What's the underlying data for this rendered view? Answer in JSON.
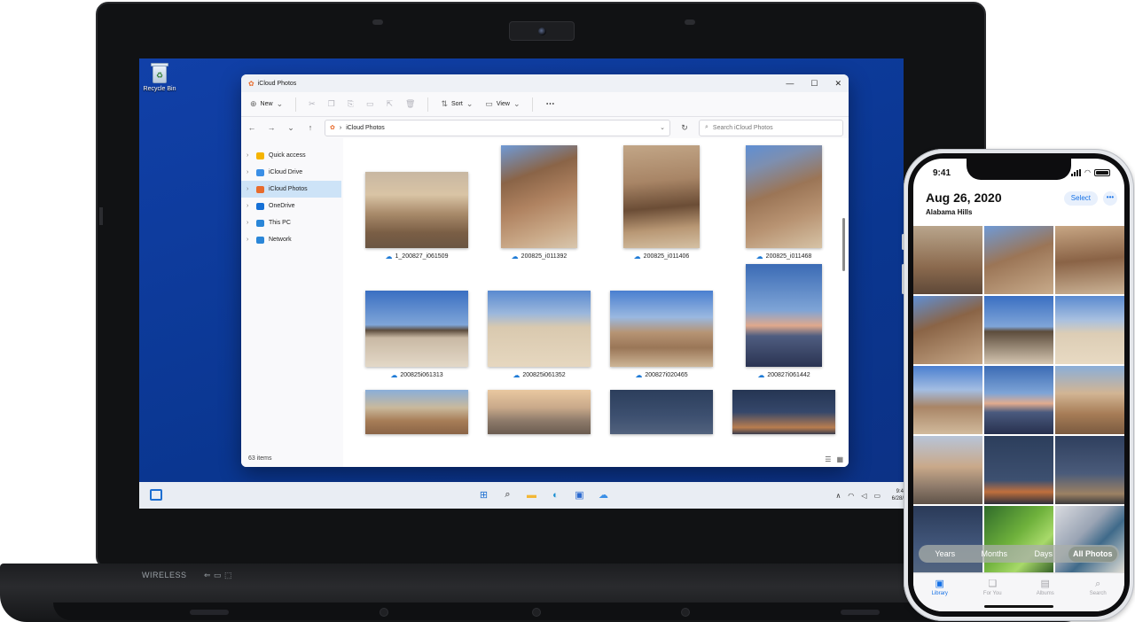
{
  "laptop": {
    "base_label_wireless": "WIRELESS",
    "base_label_ports": "⇐ ▭ ⬚"
  },
  "desktop": {
    "recycle_bin_label": "Recycle Bin"
  },
  "explorer": {
    "title": "iCloud Photos",
    "window_controls": {
      "minimize": "—",
      "maximize": "☐",
      "close": "✕"
    },
    "command_bar": {
      "new_label": "New",
      "sort_label": "Sort",
      "view_label": "View",
      "more_label": "⋯"
    },
    "address": {
      "path_separator": "›",
      "path": "iCloud Photos",
      "search_placeholder": "Search iCloud Photos"
    },
    "nav_pane": [
      {
        "label": "Quick access",
        "icon": "star-icon",
        "color": "#f5b400"
      },
      {
        "label": "iCloud Drive",
        "icon": "cloud-icon",
        "color": "#3b8fe6"
      },
      {
        "label": "iCloud Photos",
        "icon": "photos-icon",
        "color": "#e86b2c",
        "selected": true
      },
      {
        "label": "OneDrive",
        "icon": "onedrive-icon",
        "color": "#1670d6"
      },
      {
        "label": "This PC",
        "icon": "computer-icon",
        "color": "#2a86d8"
      },
      {
        "label": "Network",
        "icon": "network-icon",
        "color": "#2a86d8"
      }
    ],
    "files": [
      {
        "name": "1_200827_i061509",
        "w": 116,
        "h": 86,
        "bg": "linear-gradient(180deg,#c8b7a2 0%,#d9c4a5 30%,#a88a6a 55%,#7a5e45 80%,#6b5643 100%)"
      },
      {
        "name": "200825_i011392",
        "w": 86,
        "h": 116,
        "bg": "linear-gradient(160deg,#6f9ad6 0%,#8a6447 30%,#b08361 55%,#c9a887 80%,#d8c6ad 100%)"
      },
      {
        "name": "200825_i011406",
        "w": 86,
        "h": 116,
        "bg": "linear-gradient(175deg,#c2a687 0%,#a88566 35%,#6b4d36 60%,#b89774 80%,#d4c0a3 100%)"
      },
      {
        "name": "200825_i011468",
        "w": 86,
        "h": 116,
        "bg": "linear-gradient(160deg,#5f8fd4 0%,#7d8fb0 20%,#9b7556 45%,#b89372 70%,#d6c3a6 100%)"
      },
      {
        "name": "200825i061313",
        "w": 116,
        "h": 86,
        "bg": "linear-gradient(180deg,#3a6fc2 0%,#7fa5d8 45%,#5c4c3c 52%,#c9b9a4 62%,#e3d8c7 100%)"
      },
      {
        "name": "200825i061352",
        "w": 116,
        "h": 86,
        "bg": "linear-gradient(180deg,#5a8ad0 0%,#9bb7dc 30%,#d9c9af 48%,#e6d7bf 100%)"
      },
      {
        "name": "200827i020465",
        "w": 116,
        "h": 86,
        "bg": "linear-gradient(180deg,#4a7fd0 0%,#9ab8e0 35%,#b69474 55%,#9a7657 75%,#cdb596 100%)"
      },
      {
        "name": "200827i061442",
        "w": 86,
        "h": 116,
        "bg": "linear-gradient(180deg,#3b6bb5 0%,#7ea4d6 45%,#e0a98c 60%,#4f5d80 70%,#2a3352 100%)"
      },
      {
        "name": "",
        "w": 116,
        "h": 50,
        "bg": "linear-gradient(180deg,#8aaed8 0%,#c9b99c 40%,#a77d57 70%,#8a6446 100%)"
      },
      {
        "name": "",
        "w": 116,
        "h": 50,
        "bg": "linear-gradient(180deg,#e9c8a0 0%,#c9a98a 40%,#8d7a6a 70%,#6b5c50 100%)"
      },
      {
        "name": "",
        "w": 116,
        "h": 50,
        "bg": "linear-gradient(180deg,#2c3e5c 0%,#3d5070 60%,#52627d 100%)"
      },
      {
        "name": "",
        "w": 116,
        "h": 50,
        "bg": "linear-gradient(180deg,#253553 0%,#35476a 50%,#b97d4f 85%,#3a3c4c 100%)"
      }
    ],
    "status_text": "63 items",
    "view_icons": {
      "details": "☰",
      "tiles": "▦"
    }
  },
  "taskbar": {
    "apps": [
      {
        "name": "start-icon",
        "glyph": "⊞",
        "color": "#1d6fd1"
      },
      {
        "name": "search-icon",
        "glyph": "⌕",
        "color": "#222222"
      },
      {
        "name": "file-explorer-icon",
        "glyph": "▬",
        "color": "#f2b736"
      },
      {
        "name": "edge-icon",
        "glyph": "◐",
        "color": "#1b8fd2"
      },
      {
        "name": "store-icon",
        "glyph": "▣",
        "color": "#2b6ad0"
      },
      {
        "name": "icloud-icon",
        "glyph": "☁",
        "color": "#3b8fe6"
      }
    ],
    "tray": {
      "chevron": "∧",
      "wifi": "◠",
      "volume": "◁",
      "battery": "▭"
    },
    "clock_time": "9:4",
    "clock_date": "6/28/"
  },
  "phone": {
    "status_time": "9:41",
    "date_header": "Aug 26, 2020",
    "location": "Alabama Hills",
    "select_label": "Select",
    "more_label": "•••",
    "grid": [
      "linear-gradient(180deg,#b9a58c,#8b6a4e 60%,#5e4838)",
      "linear-gradient(160deg,#6f9ad6,#9b7556 45%,#c8ab8b)",
      "linear-gradient(175deg,#c7a684,#8a6346 50%,#cbb396)",
      "linear-gradient(160deg,#5f8fd4,#8a6446 40%,#c5a686)",
      "linear-gradient(180deg,#3a6fc2,#7fa5d8 45%,#5c4c3c 52%,#d5c6b1)",
      "linear-gradient(180deg,#5a8ad0,#a8c0e0 35%,#dccdb5 55%,#e8dac3)",
      "linear-gradient(180deg,#4a7fd0,#a3bde2 35%,#a98566 60%,#d1ba9c)",
      "linear-gradient(180deg,#3b6bb5,#7ea4d6 40%,#e1ac8e 55%,#4a5a7e 68%,#27304e)",
      "linear-gradient(180deg,#8aaed8,#d2b594 40%,#a77d57 70%,#7a5a40)",
      "linear-gradient(180deg,#b7c4d8,#c9a98a 45%,#8d7a6a 75%,#5f5248)",
      "linear-gradient(180deg,#2c3e5c,#3d5070 65%,#c0703d 82%,#2d2f3b)",
      "linear-gradient(180deg,#2f3f5e,#4a5b7a 55%,#9c8163 85%,#3b3a3c)",
      "linear-gradient(180deg,#2a3a58,#43587c 60%,#53657f)",
      "linear-gradient(135deg,#2f6b2a,#6fb23c 45%,#a8d96a 70%,#2f5a25)",
      "linear-gradient(135deg,#d9dbe0,#9aa4b4 40%,#3f6a8a 60%,#e6e2d8)"
    ],
    "segments": [
      {
        "label": "Years"
      },
      {
        "label": "Months"
      },
      {
        "label": "Days"
      },
      {
        "label": "All Photos",
        "active": true
      }
    ],
    "tabs": [
      {
        "label": "Library",
        "glyph": "▣",
        "active": true
      },
      {
        "label": "For You",
        "glyph": "❏"
      },
      {
        "label": "Albums",
        "glyph": "▤"
      },
      {
        "label": "Search",
        "glyph": "⌕"
      }
    ]
  }
}
